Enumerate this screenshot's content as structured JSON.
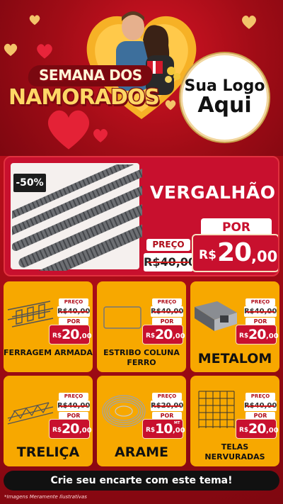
{
  "hero": {
    "title_line1": "SEMANA DOS",
    "title_line2": "NAMORADOS",
    "logo_line1": "Sua Logo",
    "logo_line2": "Aqui"
  },
  "main_product": {
    "discount": "-50%",
    "name": "VERGALHÃO",
    "preco_label": "PREÇO",
    "old_price": "R$40,00",
    "por_label": "POR",
    "currency": "R$",
    "price_int": "20",
    "price_dec": ",00"
  },
  "products": [
    {
      "name": "FERRAGEM ARMADA",
      "preco_label": "PREÇO",
      "old_price": "R$40,00",
      "por_label": "POR",
      "currency": "R$",
      "price_int": "20",
      "price_dec": ",00",
      "unit": "",
      "icon": "reinforcement-cage-icon"
    },
    {
      "name": "ESTRIBO COLUNA FERRO",
      "preco_label": "PREÇO",
      "old_price": "R$40,00",
      "por_label": "POR",
      "currency": "R$",
      "price_int": "20",
      "price_dec": ",00",
      "unit": "",
      "icon": "stirrup-icon"
    },
    {
      "name": "METALOM",
      "preco_label": "PREÇO",
      "old_price": "R$40,00",
      "por_label": "POR",
      "currency": "R$",
      "price_int": "20",
      "price_dec": ",00",
      "unit": "",
      "icon": "metal-tube-icon"
    },
    {
      "name": "TRELIÇA",
      "preco_label": "PREÇO",
      "old_price": "R$40,00",
      "por_label": "POR",
      "currency": "R$",
      "price_int": "20",
      "price_dec": ",00",
      "unit": "",
      "icon": "truss-icon"
    },
    {
      "name": "ARAME",
      "preco_label": "PREÇO",
      "old_price": "R$20,00",
      "por_label": "POR",
      "currency": "R$",
      "price_int": "10",
      "price_dec": ",00",
      "unit": "MT",
      "icon": "wire-coil-icon"
    },
    {
      "name": "TELAS NERVURADAS",
      "preco_label": "PREÇO",
      "old_price": "R$40,00",
      "por_label": "POR",
      "currency": "R$",
      "price_int": "20",
      "price_dec": ",00",
      "unit": "",
      "icon": "mesh-grid-icon"
    }
  ],
  "cta": "Crie seu encarte com este tema!",
  "footnote": "*Imagens Meramente Ilustrativas",
  "colors": {
    "background": "#b80f1a",
    "card_yellow": "#f7a800",
    "price_red": "#c8102e",
    "cta_black": "#111111"
  }
}
